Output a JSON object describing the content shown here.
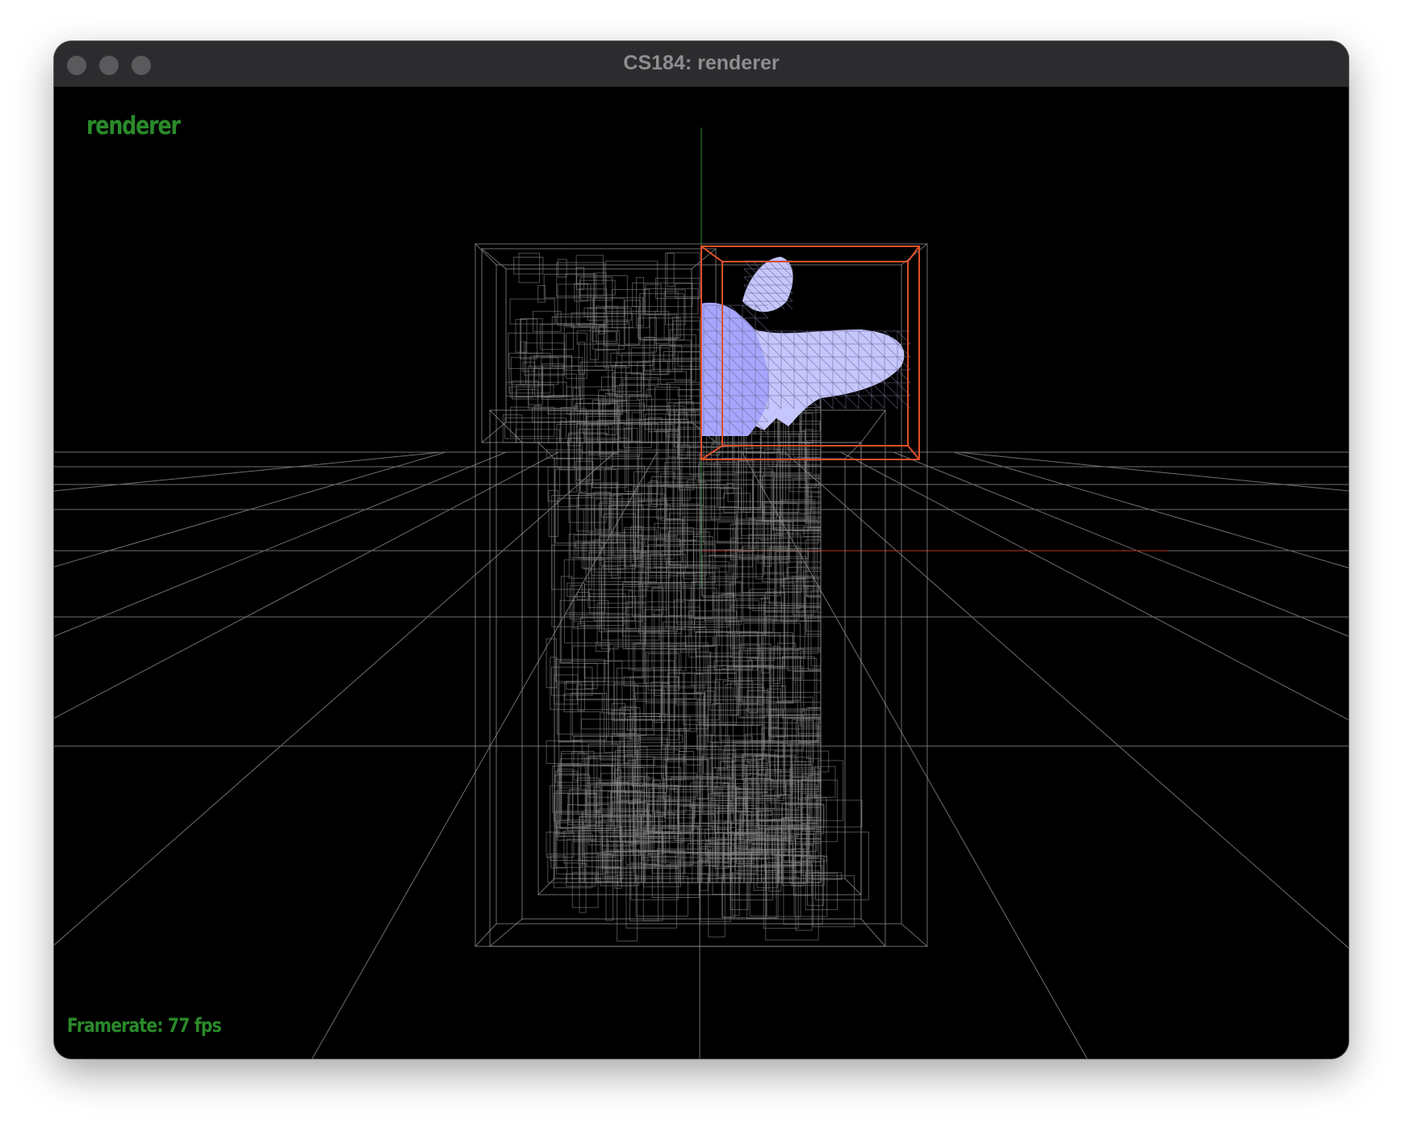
{
  "window": {
    "title": "CS184: renderer"
  },
  "viewport": {
    "app_label": "renderer",
    "framerate_text": "Framerate: 77 fps"
  },
  "colors": {
    "grid_line": "#7d7d7d",
    "bvh_box": "#8a8a8a",
    "selected_box": "#e0502a",
    "mesh_fill": "#a6a6ff",
    "mesh_fill_light": "#c6c6ff",
    "overlay_text": "#2a8a2a",
    "axis_x": "#c0392b",
    "axis_y": "#2e8b3a"
  },
  "icons": {
    "close": "traffic-light-close-icon",
    "minimize": "traffic-light-minimize-icon",
    "zoom": "traffic-light-zoom-icon"
  }
}
